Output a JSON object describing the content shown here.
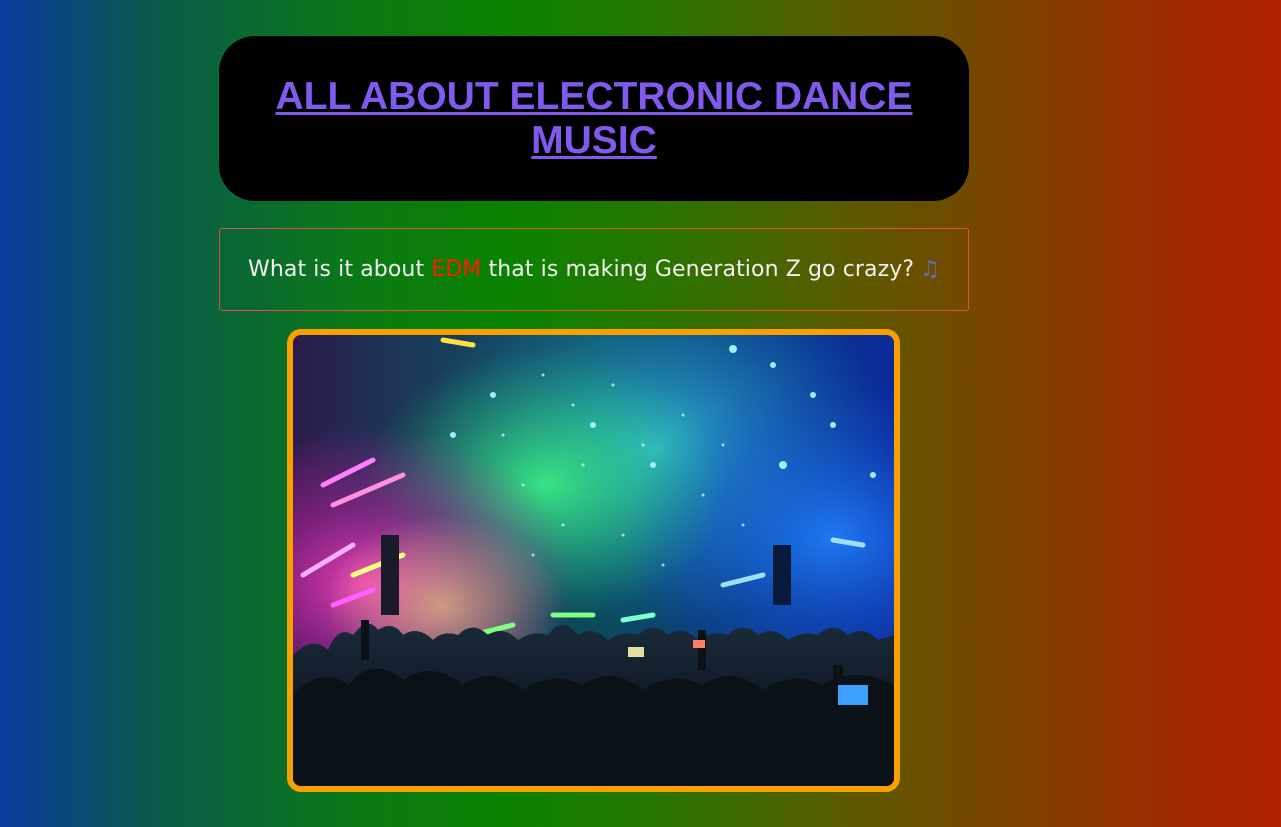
{
  "header": {
    "title": "ALL ABOUT ELECTRONIC DANCE MUSIC"
  },
  "question": {
    "before": "What is it about ",
    "highlight": "EDM",
    "after": " that is making Generation Z go crazy?",
    "icon": "musical-notes-icon",
    "icon_glyph": "♫"
  },
  "image": {
    "description_icon": "concert-photo"
  },
  "colors": {
    "title": "#8159ec",
    "highlight": "#ff1a00",
    "frame_border": "#f7a000",
    "question_border": "#d9534a",
    "header_bg": "#000000"
  }
}
